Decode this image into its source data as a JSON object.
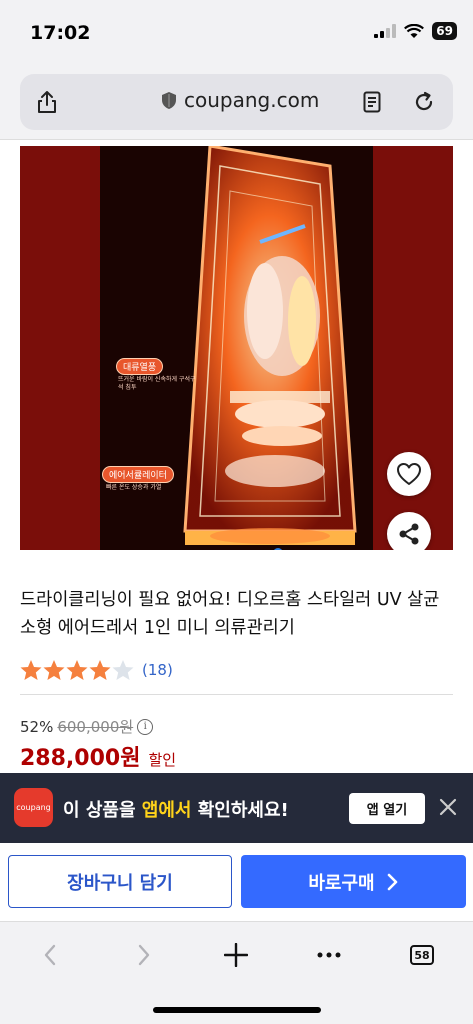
{
  "status_bar": {
    "time": "17:02",
    "battery": "69"
  },
  "browser": {
    "domain": "coupang.com"
  },
  "hero": {
    "label_convection": "대류열풍",
    "label_convection_sub": "뜨거운 바람이 신속하게 구석구석 침투",
    "label_aircirculator": "에어서큘레이터",
    "label_aircirculator_sub": "빠른 온도 상승과 가열"
  },
  "product": {
    "title": "드라이클리닝이 필요 없어요! 디오르홈 스타일러 UV 살균 소형 에어드레서 1인 미니 의류관리기",
    "rating": 4.5,
    "review_count": "(18)",
    "discount_percent": "52%",
    "original_price": "600,000원",
    "sale_price": "288,000원",
    "sale_tag": "할인"
  },
  "app_banner": {
    "logo_text": "coupang",
    "text_before": "이 상품을 ",
    "text_accent": "앱에서",
    "text_after": " 확인하세요!",
    "open_button": "앱 열기"
  },
  "buy_bar": {
    "cart_label": "장바구니 담기",
    "buy_label": "바로구매"
  },
  "toolbar": {
    "tab_count": "58"
  },
  "colors": {
    "brand_blue": "#346aff",
    "price_red": "#ae0000",
    "star_orange": "#f5803e",
    "banner_bg": "#252a3a"
  }
}
